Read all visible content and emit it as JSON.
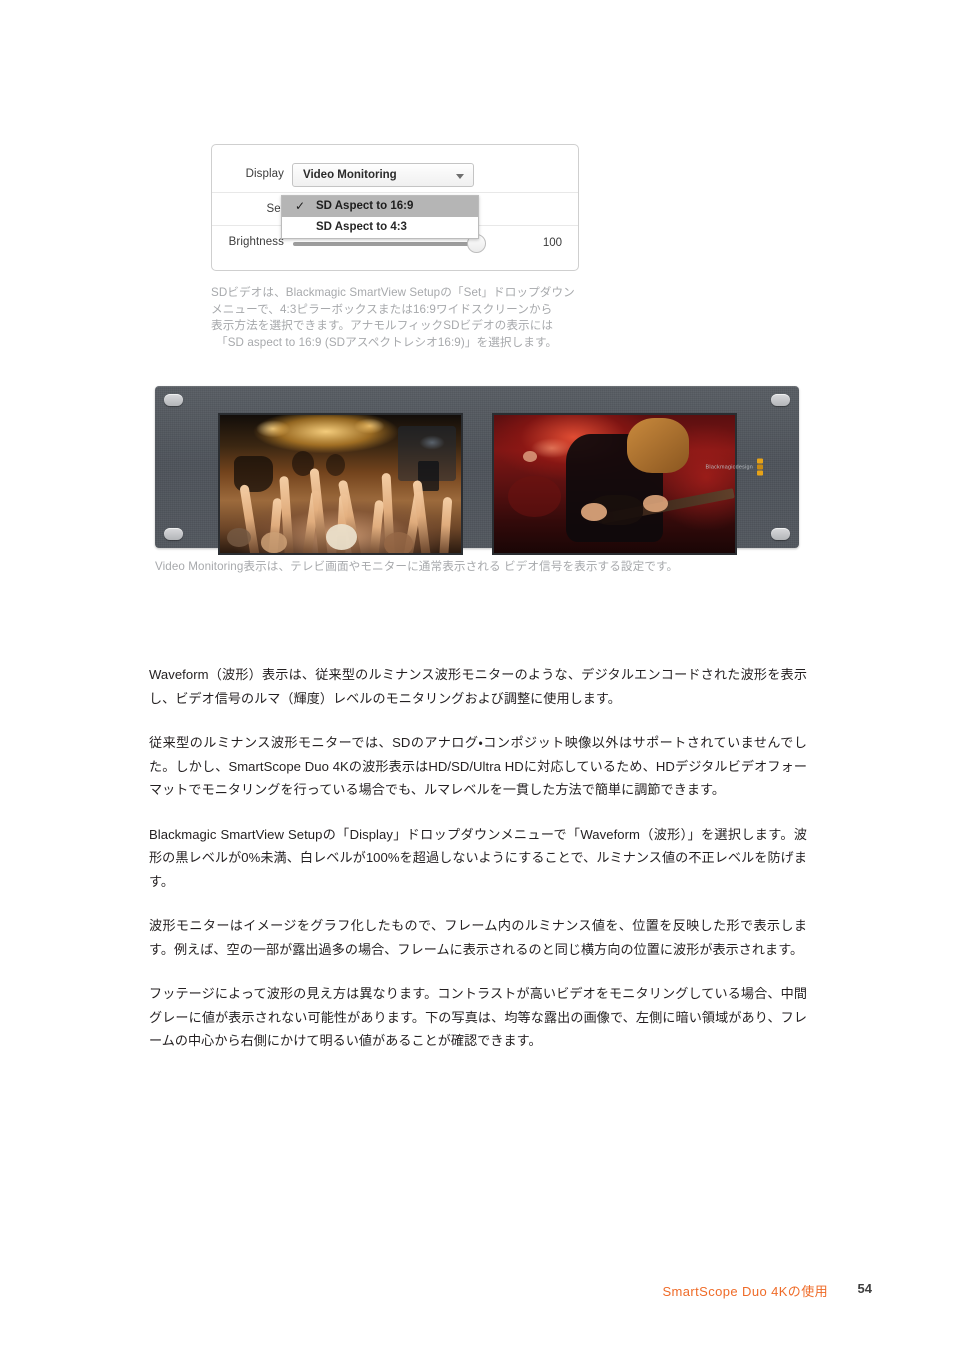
{
  "dialog": {
    "rows": [
      {
        "label": "Display",
        "value": "Video Monitoring"
      },
      {
        "label": "Set",
        "value": "SD Aspect to 16:9"
      },
      {
        "label": "Brightness",
        "value": "100"
      }
    ],
    "popup_options": [
      {
        "label": "SD Aspect to 16:9",
        "checked": true,
        "check_glyph": "✓"
      },
      {
        "label": "SD Aspect to 4:3",
        "checked": false,
        "check_glyph": ""
      }
    ],
    "brightness_value": "100"
  },
  "caption_1": {
    "line1": "SDビデオは、Blackmagic SmartView Setupの「Set」ドロップダウン",
    "line2": "メニューで、4:3ピラーボックスまたは16:9ワイドスクリーンから",
    "line3": "表示方法を選択できます。アナモルフィックSDビデオの表示には",
    "line4": "「SD aspect to 16:9 (SDアスペクトレシオ16:9)」を選択します。"
  },
  "caption_2": {
    "text": "Video Monitoring表示は、テレビ画面やモニターに通常表示される ビデオ信号を表示する設定です。"
  },
  "device": {
    "brand_word": "Blackmagicdesign",
    "screen_left_alt": "コンサート観客の映像",
    "screen_right_alt": "赤い照明下のギタリストの映像"
  },
  "body": {
    "p1": "Waveform（波形）表示は、従来型のルミナンス波形モニターのような、デジタルエンコードされた波形を表示し、ビデオ信号のルマ（輝度）レベルのモニタリングおよび調整に使用します。",
    "p2": "従来型のルミナンス波形モニターでは、SDのアナログ・コンポジット映像以外はサポートされていませんでした。しかし、SmartScope Duo 4Kの波形表示はHD/SD/Ultra HDに対応しているため、HDデジタルビデオフォーマットでモニタリングを行っている場合でも、ルマレベルを一貫した方法で簡単に調節できます。",
    "p3": "Blackmagic SmartView Setupの「Display」ドロップダウンメニューで「Waveform（波形）」を選択します。波形の黒レベルが0%未満、白レベルが100%を超過しないようにすることで、ルミナンス値の不正レベルを防げます。",
    "p4": "波形モニターはイメージをグラフ化したもので、フレーム内のルミナンス値を、位置を反映した形で表示します。例えば、空の一部が露出過多の場合、フレームに表示されるのと同じ横方向の位置に波形が表示されます。",
    "p5": "フッテージによって波形の見え方は異なります。コントラストが高いビデオをモニタリングしている場合、中間グレーに値が表示されない可能性があります。下の写真は、均等な露出の画像で、左側に暗い領域があり、フレームの中心から右側にかけて明るい値があることが確認できます。"
  },
  "footer": {
    "chapter": "SmartScope Duo 4Kの使用",
    "page": "54"
  },
  "colors": {
    "accent": "#ef6b28",
    "caption": "#a7a9ac",
    "body_text": "#231f20",
    "device_body": "#52575e",
    "logo_amber": "#e8a317"
  }
}
